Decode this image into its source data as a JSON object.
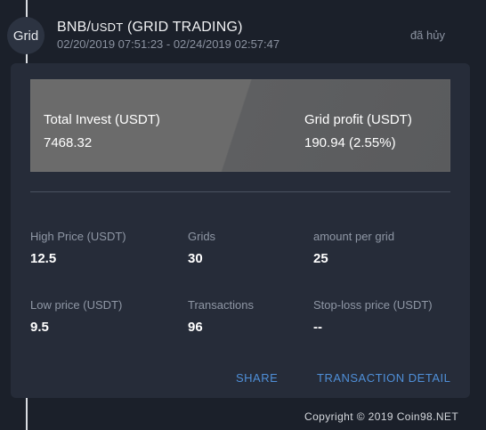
{
  "badge": {
    "label": "Grid"
  },
  "header": {
    "pair_base": "BNB/",
    "pair_quote": "USDT",
    "strategy": " (GRID TRADING)",
    "dates": "02/20/2019 07:51:23 - 02/24/2019 02:57:47",
    "status": "đã hủy"
  },
  "summary": {
    "total_invest_label": "Total Invest (USDT)",
    "total_invest_value": "7468.32",
    "grid_profit_label": "Grid profit (USDT)",
    "grid_profit_value": "190.94 (2.55%)"
  },
  "stats": {
    "high_price_label": "High Price (USDT)",
    "high_price_value": "12.5",
    "grids_label": "Grids",
    "grids_value": "30",
    "amount_per_grid_label": "amount per grid",
    "amount_per_grid_value": "25",
    "low_price_label": "Low price (USDT)",
    "low_price_value": "9.5",
    "transactions_label": "Transactions",
    "transactions_value": "96",
    "stop_loss_label": "Stop-loss price (USDT)",
    "stop_loss_value": "--"
  },
  "actions": {
    "share": "SHARE",
    "transaction_detail": "TRANSACTION DETAIL"
  },
  "footer": {
    "copyright": "Copyright © 2019 Coin98.NET"
  },
  "colors": {
    "background": "#1b202a",
    "card": "#262c39",
    "accent": "#4f8fd8",
    "muted_text": "#8f97a5"
  }
}
